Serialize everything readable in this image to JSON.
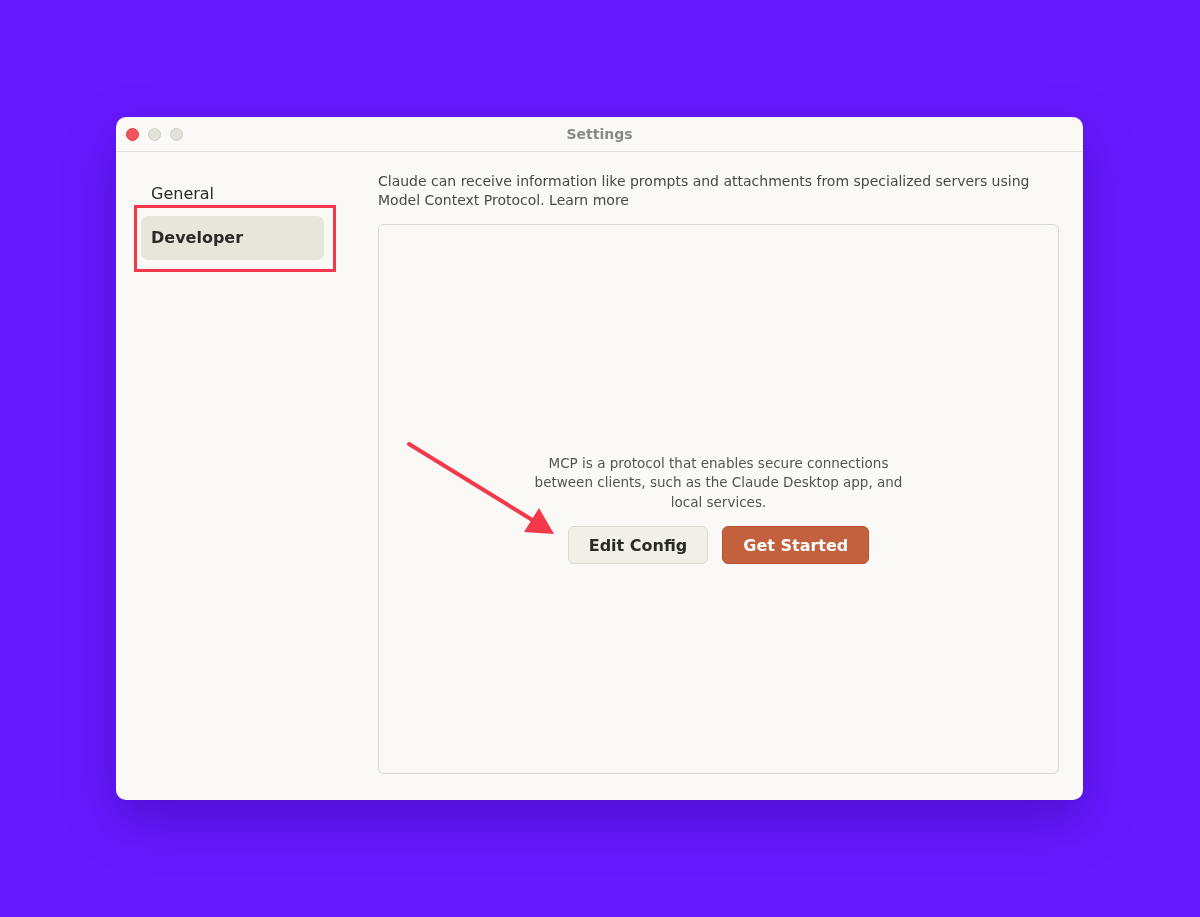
{
  "window": {
    "title": "Settings",
    "controls": [
      {
        "kind": "close"
      },
      {
        "kind": "minimize"
      },
      {
        "kind": "zoom"
      }
    ]
  },
  "sidebar": {
    "items": [
      {
        "label": "General",
        "selected": false
      },
      {
        "label": "Developer",
        "selected": true
      }
    ]
  },
  "intro": {
    "text": "Claude can receive information like prompts and attachments from specialized servers using Model Context Protocol.",
    "link": "Learn more"
  },
  "empty_state": {
    "message": "MCP is a protocol that enables secure connections between clients, such as the Claude Desktop app, and local services.",
    "buttons": [
      {
        "label": "Edit Config",
        "kind": "secondary"
      },
      {
        "label": "Get Started",
        "kind": "primary"
      }
    ]
  }
}
